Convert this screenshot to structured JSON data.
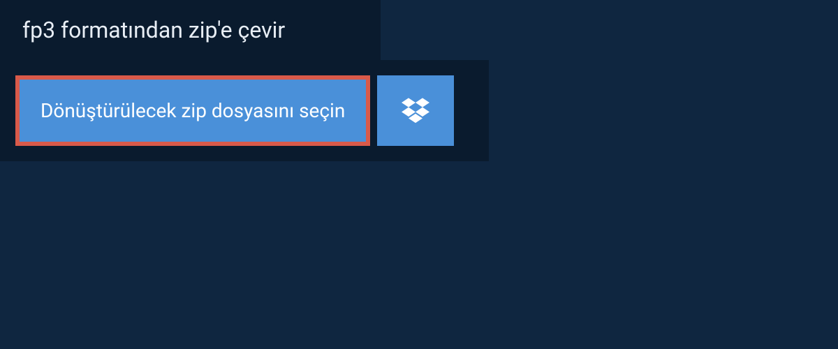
{
  "header": {
    "title": "fp3 formatından zip'e çevir"
  },
  "actions": {
    "choose_file_label": "Dönüştürülecek zip dosyasını seçin",
    "dropbox_icon": "dropbox-icon"
  },
  "colors": {
    "background": "#0f2640",
    "panel": "#0a1b2e",
    "button": "#4a90d9",
    "button_border": "#d95a4a",
    "text_light": "#e8eef5",
    "text_white": "#ffffff"
  }
}
